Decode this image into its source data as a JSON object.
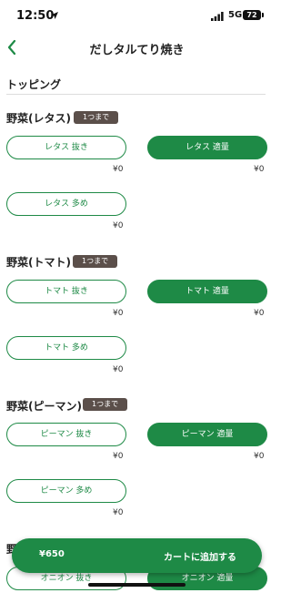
{
  "status_bar": {
    "time": "12:50",
    "network": "5G",
    "battery": "72"
  },
  "nav": {
    "title": "だしタルてり焼き"
  },
  "section": {
    "title": "トッピング"
  },
  "groups": [
    {
      "title": "野菜(レタス)",
      "limit": "1つまで",
      "options": [
        {
          "label": "レタス 抜き",
          "price": "¥0",
          "selected": false
        },
        {
          "label": "レタス 適量",
          "price": "¥0",
          "selected": true
        },
        {
          "label": "レタス 多め",
          "price": "¥0",
          "selected": false
        }
      ]
    },
    {
      "title": "野菜(トマト)",
      "limit": "1つまで",
      "options": [
        {
          "label": "トマト 抜き",
          "price": "¥0",
          "selected": false
        },
        {
          "label": "トマト 適量",
          "price": "¥0",
          "selected": true
        },
        {
          "label": "トマト 多め",
          "price": "¥0",
          "selected": false
        }
      ]
    },
    {
      "title": "野菜(ピーマン)",
      "limit": "1つまで",
      "options": [
        {
          "label": "ピーマン 抜き",
          "price": "¥0",
          "selected": false
        },
        {
          "label": "ピーマン 適量",
          "price": "¥0",
          "selected": true
        },
        {
          "label": "ピーマン 多め",
          "price": "¥0",
          "selected": false
        }
      ]
    },
    {
      "title": "野",
      "options": [
        {
          "label": "オニオン 抜き",
          "selected": false
        },
        {
          "label": "オニオン 適量",
          "selected": true
        }
      ]
    }
  ],
  "cart": {
    "total": "¥650",
    "label": "カートに追加する"
  },
  "colors": {
    "accent": "#1e8a46",
    "badge": "#5b4f4a"
  },
  "icons": {
    "back": "chevron-left-icon",
    "location": "location-arrow-icon",
    "signal": "signal-bars-icon"
  }
}
